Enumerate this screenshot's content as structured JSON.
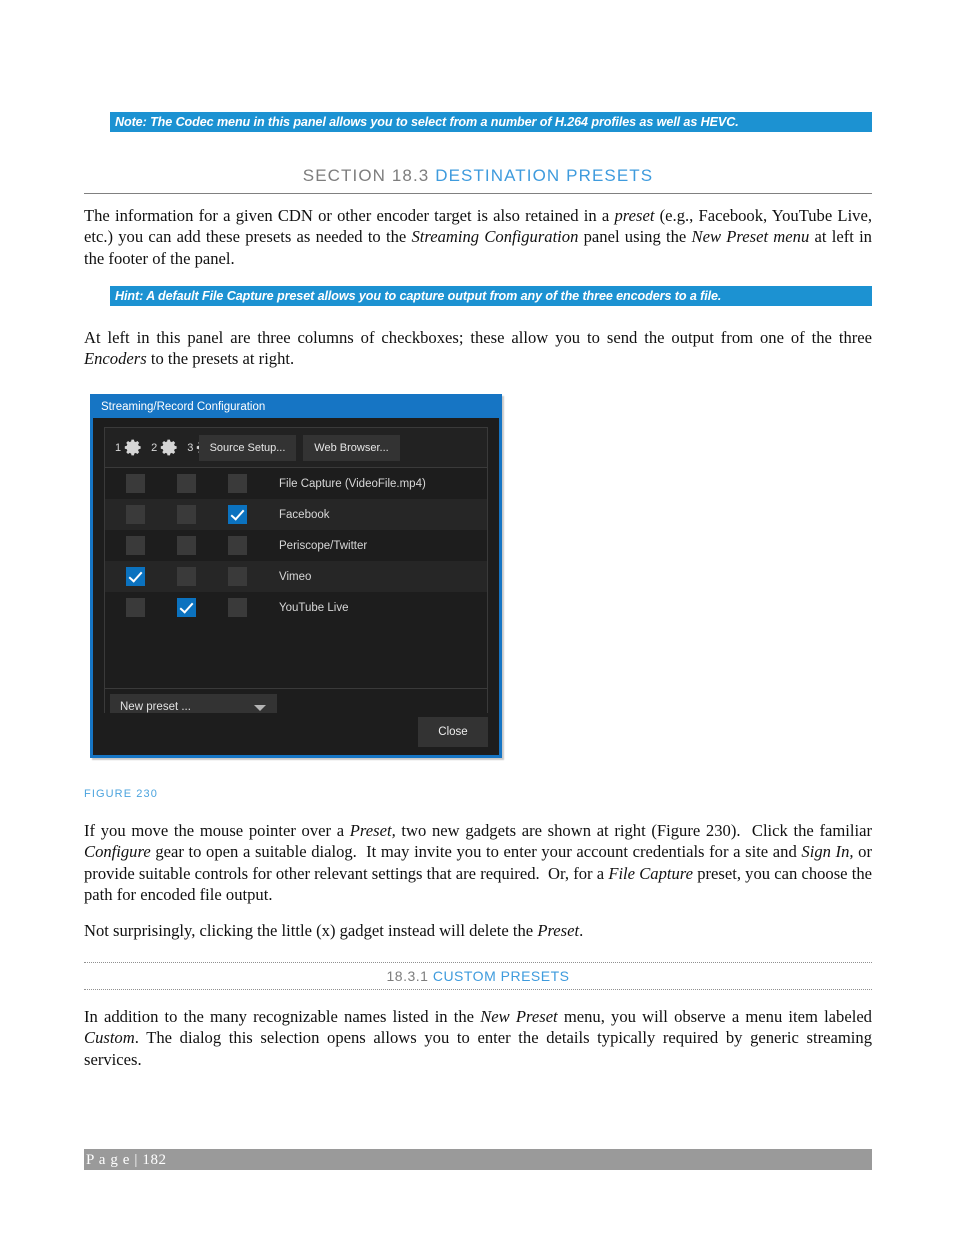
{
  "banners": {
    "note": "Note: The Codec menu in this panel allows you to select from a number of H.264 profiles as well as HEVC.",
    "hint": "Hint: A default File Capture preset allows you to capture output from any of the three encoders to a file."
  },
  "headings": {
    "section_number": "SECTION 18.3",
    "section_title": "DESTINATION PRESETS",
    "subsection_number": "18.3.1",
    "subsection_title": "CUSTOM PRESETS"
  },
  "paragraphs": {
    "p1": "The information for a given CDN or other encoder target is also retained in a preset (e.g., Facebook, YouTube Live, etc.) you can add these presets as needed to the Streaming Configuration panel using the New Preset menu at left in the footer of the panel.",
    "p2": "At left in this panel are three columns of checkboxes; these allow you to send the output from one of the three Encoders to the presets at right.",
    "p3": "If you move the mouse pointer over a Preset, two new gadgets are shown at right (Figure 230).  Click the familiar Configure gear to open a suitable dialog.  It may invite you to enter your account credentials for a site and Sign In, or provide suitable controls for other relevant settings that are required.  Or, for a File Capture preset, you can choose the path for encoded file output.",
    "p4": "Not surprisingly, clicking the little (x) gadget instead will delete the Preset.",
    "p5": "In addition to the many recognizable names listed in the New Preset menu, you will observe a menu item labeled Custom. The dialog this selection opens allows you to enter the details typically required by generic streaming services."
  },
  "figure": {
    "caption": "FIGURE 230"
  },
  "dialog": {
    "title": "Streaming/Record Configuration",
    "encoder_numbers": [
      "1",
      "2",
      "3"
    ],
    "buttons": {
      "source_setup": "Source Setup...",
      "web_browser": "Web Browser...",
      "close": "Close"
    },
    "new_preset_label": "New preset ...",
    "rows": [
      {
        "label": "File Capture (VideoFile.mp4)",
        "checks": [
          false,
          false,
          false
        ]
      },
      {
        "label": "Facebook",
        "checks": [
          false,
          false,
          true
        ]
      },
      {
        "label": "Periscope/Twitter",
        "checks": [
          false,
          false,
          false
        ]
      },
      {
        "label": "Vimeo",
        "checks": [
          true,
          false,
          false
        ]
      },
      {
        "label": "YouTube Live",
        "checks": [
          false,
          true,
          false
        ]
      }
    ]
  },
  "footer": {
    "page_label": "P a g e  |  182"
  },
  "colors": {
    "banner_blue": "#1C92D2",
    "heading_blue": "#3E9BDD",
    "heading_gray": "#7D7D7D",
    "caption_blue": "#4BA3DE",
    "dialog_accent": "#1675C4",
    "checkbox_blue": "#0B72BF",
    "footer_gray": "#9A9A9A"
  }
}
